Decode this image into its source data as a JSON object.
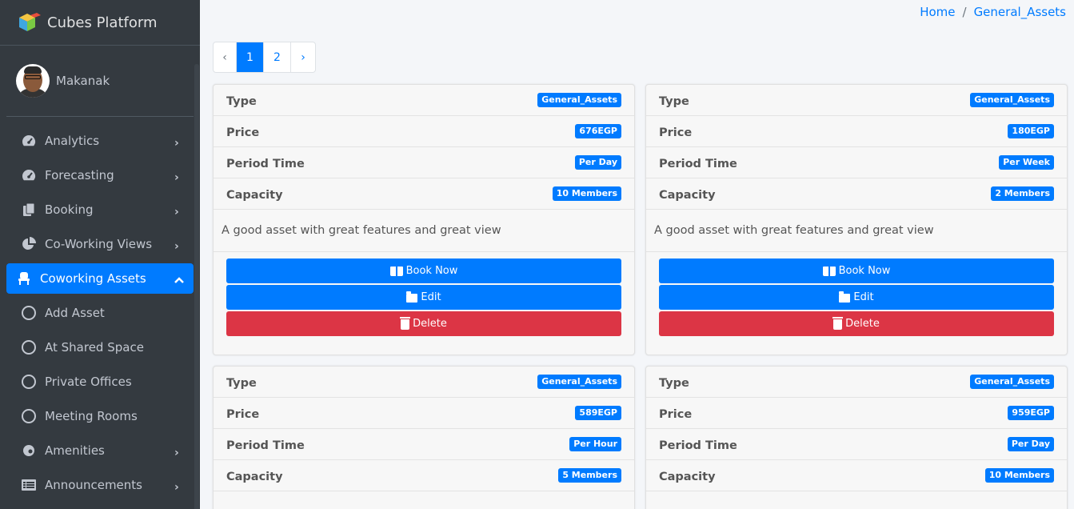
{
  "brand": {
    "name": "Cubes Platform"
  },
  "user": {
    "name": "Makanak"
  },
  "sidebar": {
    "items": [
      {
        "label": "Analytics",
        "icon": "tachometer-icon",
        "has_children": true
      },
      {
        "label": "Forecasting",
        "icon": "tachometer-icon",
        "has_children": true
      },
      {
        "label": "Booking",
        "icon": "copy-icon",
        "has_children": true
      },
      {
        "label": "Co-Working Views",
        "icon": "pie-chart-icon",
        "has_children": true
      },
      {
        "label": "Coworking Assets",
        "icon": "chair-icon",
        "has_children": true,
        "active": true,
        "expanded": true
      },
      {
        "label": "Add Asset",
        "icon": "circle-icon",
        "sub": true
      },
      {
        "label": "At Shared Space",
        "icon": "circle-icon",
        "sub": true
      },
      {
        "label": "Private Offices",
        "icon": "circle-icon",
        "sub": true
      },
      {
        "label": "Meeting Rooms",
        "icon": "circle-icon",
        "sub": true
      },
      {
        "label": "Amenities",
        "icon": "cookie-icon",
        "has_children": true
      },
      {
        "label": "Announcements",
        "icon": "list-icon",
        "has_children": true
      }
    ]
  },
  "breadcrumb": {
    "home": "Home",
    "sep": "/",
    "current": "General_Assets"
  },
  "pagination": {
    "prev": "‹",
    "next": "›",
    "pages": [
      "1",
      "2"
    ],
    "current_page": "1"
  },
  "labels": {
    "type": "Type",
    "price": "Price",
    "period": "Period Time",
    "capacity": "Capacity",
    "book": "Book Now",
    "edit": "Edit",
    "delete": "Delete"
  },
  "assets": [
    {
      "type": "General_Assets",
      "price": "676EGP",
      "period": "Per Day",
      "capacity": "10 Members",
      "description": "A good asset with great features and great view"
    },
    {
      "type": "General_Assets",
      "price": "180EGP",
      "period": "Per Week",
      "capacity": "2 Members",
      "description": "A good asset with great features and great view"
    },
    {
      "type": "General_Assets",
      "price": "589EGP",
      "period": "Per Hour",
      "capacity": "5 Members",
      "description": ""
    },
    {
      "type": "General_Assets",
      "price": "959EGP",
      "period": "Per Day",
      "capacity": "10 Members",
      "description": ""
    }
  ],
  "colors": {
    "primary": "#007bff",
    "danger": "#dc3545",
    "sidebar": "#343a40",
    "background": "#f4f6f9"
  }
}
